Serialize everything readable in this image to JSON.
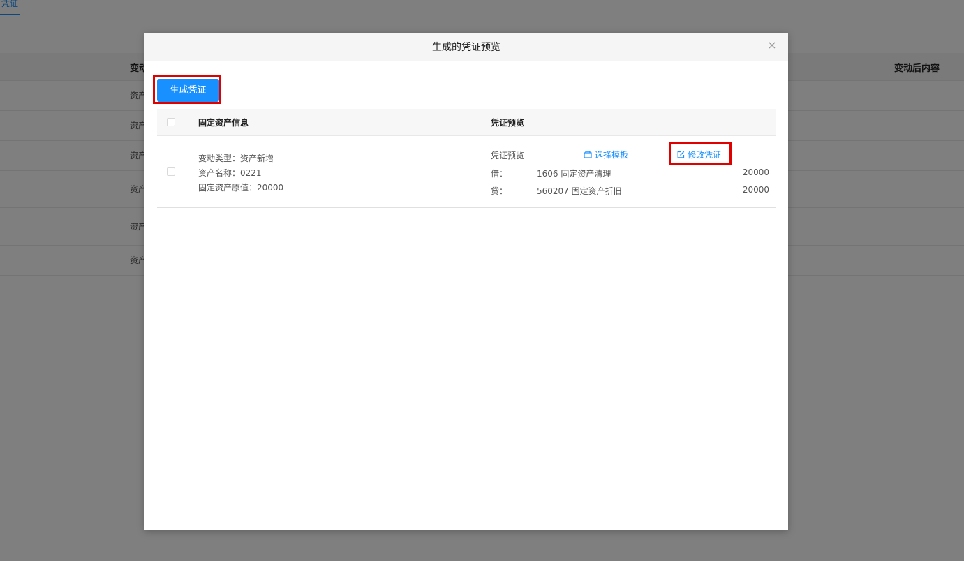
{
  "background": {
    "tab_label": "凭证",
    "header_cols": [
      "变动",
      "变动后内容"
    ],
    "rows": [
      "资产",
      "资产",
      "资产",
      "资产",
      "资产",
      "资产"
    ]
  },
  "modal": {
    "title": "生成的凭证预览",
    "close_glyph": "×",
    "generate_button": "生成凭证",
    "columns": {
      "info": "固定资产信息",
      "preview": "凭证预览"
    },
    "row": {
      "change_type_label": "变动类型：",
      "change_type_value": "资产新增",
      "asset_name_label": "资产名称：",
      "asset_name_value": "0221",
      "original_value_label": "固定资产原值：",
      "original_value_value": "20000",
      "preview_label": "凭证预览",
      "select_template": "选择模板",
      "edit_voucher": "修改凭证",
      "entries": [
        {
          "direction": "借：",
          "account": "1606 固定资产清理",
          "amount": "20000"
        },
        {
          "direction": "贷：",
          "account": "560207 固定资产折旧",
          "amount": "20000"
        }
      ]
    }
  },
  "colors": {
    "accent": "#1890ff",
    "highlight": "#e00000",
    "mask": "rgba(0,0,0,0.5)"
  },
  "icons": {
    "template": "template-icon",
    "edit": "edit-icon",
    "close": "close-icon"
  }
}
